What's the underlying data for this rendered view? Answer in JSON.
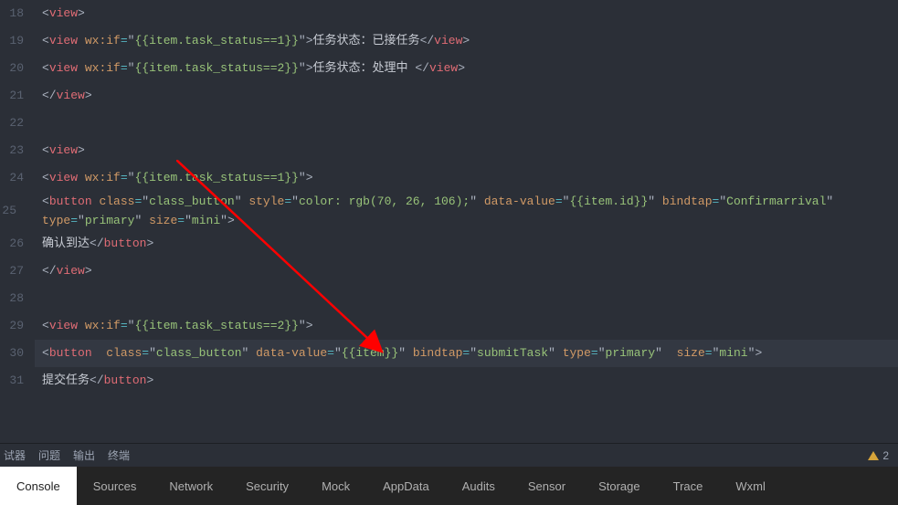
{
  "lineNumbers": [
    "18",
    "19",
    "20",
    "21",
    "22",
    "23",
    "24",
    "25",
    "26",
    "27",
    "28",
    "29",
    "30",
    "31"
  ],
  "lines": {
    "l18": [
      [
        "punc",
        "<"
      ],
      [
        "tag",
        "view"
      ],
      [
        "punc",
        ">"
      ]
    ],
    "l19": [
      [
        "punc",
        "<"
      ],
      [
        "tag",
        "view"
      ],
      [
        "text",
        " "
      ],
      [
        "attr",
        "wx:if"
      ],
      [
        "op",
        "="
      ],
      [
        "punc",
        "\""
      ],
      [
        "str",
        "{{item.task_status==1}}"
      ],
      [
        "punc",
        "\""
      ],
      [
        "punc",
        ">"
      ],
      [
        "text",
        "任务状态：已接任务"
      ],
      [
        "punc",
        "</"
      ],
      [
        "tag",
        "view"
      ],
      [
        "punc",
        ">"
      ]
    ],
    "l20": [
      [
        "punc",
        "<"
      ],
      [
        "tag",
        "view"
      ],
      [
        "text",
        " "
      ],
      [
        "attr",
        "wx:if"
      ],
      [
        "op",
        "="
      ],
      [
        "punc",
        "\""
      ],
      [
        "str",
        "{{item.task_status==2}}"
      ],
      [
        "punc",
        "\""
      ],
      [
        "punc",
        ">"
      ],
      [
        "text",
        "任务状态：处理中 "
      ],
      [
        "punc",
        "</"
      ],
      [
        "tag",
        "view"
      ],
      [
        "punc",
        ">"
      ]
    ],
    "l21": [
      [
        "punc",
        "</"
      ],
      [
        "tag",
        "view"
      ],
      [
        "punc",
        ">"
      ]
    ],
    "l22": [],
    "l23": [
      [
        "punc",
        "<"
      ],
      [
        "tag",
        "view"
      ],
      [
        "punc",
        ">"
      ]
    ],
    "l24": [
      [
        "punc",
        "<"
      ],
      [
        "tag",
        "view"
      ],
      [
        "text",
        " "
      ],
      [
        "attr",
        "wx:if"
      ],
      [
        "op",
        "="
      ],
      [
        "punc",
        "\""
      ],
      [
        "str",
        "{{item.task_status==1}}"
      ],
      [
        "punc",
        "\""
      ],
      [
        "punc",
        ">"
      ]
    ],
    "l25": [
      [
        "punc",
        "<"
      ],
      [
        "tag",
        "button"
      ],
      [
        "text",
        "   "
      ],
      [
        "attr",
        "class"
      ],
      [
        "op",
        "="
      ],
      [
        "punc",
        "\""
      ],
      [
        "str",
        "class_button"
      ],
      [
        "punc",
        "\""
      ],
      [
        "text",
        " "
      ],
      [
        "attr",
        "style"
      ],
      [
        "op",
        "="
      ],
      [
        "punc",
        "\""
      ],
      [
        "str",
        "color: rgb(70, 26, 106);"
      ],
      [
        "punc",
        "\""
      ],
      [
        "text",
        " "
      ],
      [
        "attr",
        "data-value"
      ],
      [
        "op",
        "="
      ],
      [
        "punc",
        "\""
      ],
      [
        "str",
        "{{item.id}}"
      ],
      [
        "punc",
        "\""
      ],
      [
        "text",
        " "
      ],
      [
        "attr",
        "bindtap"
      ],
      [
        "op",
        "="
      ],
      [
        "punc",
        "\""
      ],
      [
        "str",
        "Confirmarrival"
      ],
      [
        "punc",
        "\""
      ],
      [
        "text",
        "   "
      ],
      [
        "attr",
        "type"
      ],
      [
        "op",
        "="
      ],
      [
        "punc",
        "\""
      ],
      [
        "str",
        "primary"
      ],
      [
        "punc",
        "\""
      ],
      [
        "text",
        "  "
      ],
      [
        "attr",
        "size"
      ],
      [
        "op",
        "="
      ],
      [
        "punc",
        "\""
      ],
      [
        "str",
        "mini"
      ],
      [
        "punc",
        "\""
      ],
      [
        "punc",
        ">"
      ]
    ],
    "l26": [
      [
        "text",
        "确认到达"
      ],
      [
        "punc",
        "</"
      ],
      [
        "tag",
        "button"
      ],
      [
        "punc",
        ">"
      ]
    ],
    "l27": [
      [
        "punc",
        "</"
      ],
      [
        "tag",
        "view"
      ],
      [
        "punc",
        ">"
      ]
    ],
    "l28": [],
    "l29": [
      [
        "punc",
        "<"
      ],
      [
        "tag",
        "view"
      ],
      [
        "text",
        " "
      ],
      [
        "attr",
        "wx:if"
      ],
      [
        "op",
        "="
      ],
      [
        "punc",
        "\""
      ],
      [
        "str",
        "{{item.task_status==2}}"
      ],
      [
        "punc",
        "\""
      ],
      [
        "punc",
        ">"
      ]
    ],
    "l30": [
      [
        "punc",
        "<"
      ],
      [
        "tag",
        "button"
      ],
      [
        "text",
        "  "
      ],
      [
        "attr",
        "class"
      ],
      [
        "op",
        "="
      ],
      [
        "punc",
        "\""
      ],
      [
        "str",
        "class_button"
      ],
      [
        "punc",
        "\""
      ],
      [
        "text",
        " "
      ],
      [
        "attr",
        "data-value"
      ],
      [
        "op",
        "="
      ],
      [
        "punc",
        "\""
      ],
      [
        "str",
        "{{item}}"
      ],
      [
        "punc",
        "\""
      ],
      [
        "text",
        " "
      ],
      [
        "attr",
        "bindtap"
      ],
      [
        "op",
        "="
      ],
      [
        "punc",
        "\""
      ],
      [
        "str",
        "submitTask"
      ],
      [
        "punc",
        "\""
      ],
      [
        "text",
        " "
      ],
      [
        "attr",
        "type"
      ],
      [
        "op",
        "="
      ],
      [
        "punc",
        "\""
      ],
      [
        "str",
        "primary"
      ],
      [
        "punc",
        "\""
      ],
      [
        "text",
        "  "
      ],
      [
        "attr",
        "size"
      ],
      [
        "op",
        "="
      ],
      [
        "punc",
        "\""
      ],
      [
        "str",
        "mini"
      ],
      [
        "punc",
        "\""
      ],
      [
        "punc",
        ">"
      ]
    ],
    "l31": [
      [
        "text",
        "提交任务"
      ],
      [
        "punc",
        "</"
      ],
      [
        "tag",
        "button"
      ],
      [
        "punc",
        ">"
      ]
    ]
  },
  "midTabs": {
    "debugger": "试器",
    "problems": "问题",
    "output": "输出",
    "terminal": "终端",
    "warnCount": "2"
  },
  "panelTabs": [
    "Console",
    "Sources",
    "Network",
    "Security",
    "Mock",
    "AppData",
    "Audits",
    "Sensor",
    "Storage",
    "Trace",
    "Wxml"
  ]
}
